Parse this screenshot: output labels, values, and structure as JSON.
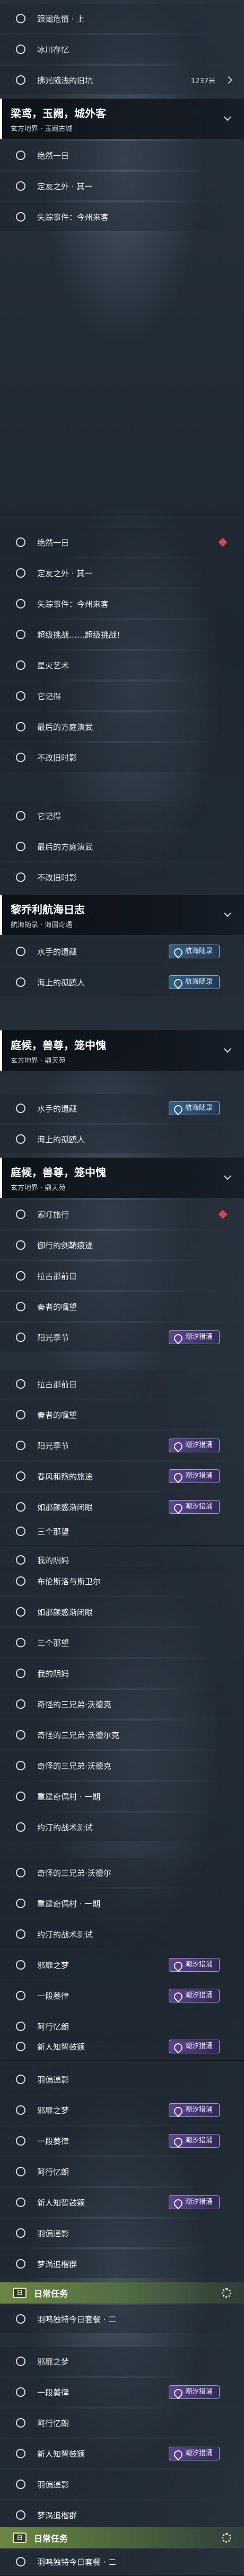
{
  "groups": {
    "g1": {
      "title": "梁鸢，玉阙，城外客",
      "subtitle": "玄方地界 · 玉阙古城"
    },
    "g2": {
      "title": "黎乔利航海日志",
      "subtitle": "航海随录 · 海国奇遇"
    },
    "g3": {
      "title": "庭候，兽尊，笼中愧",
      "subtitle": "玄方地界 · 鼎天苑"
    },
    "g4": {
      "title": "庭候，兽尊，笼中愧",
      "subtitle": "玄方地界 · 鼎天苑"
    }
  },
  "tags": {
    "tide": "潮汐猎涌",
    "sea": "航海随录"
  },
  "daily": {
    "icon": "日",
    "label": "日常任务"
  },
  "meta": {
    "count": "1237米"
  },
  "s1": [
    "跟阔危情 · 上",
    "冰川存忆",
    "拂光随浅的旧坑",
    "",
    "绝然一日",
    "定友之外 · 其一",
    "失踪事件：今州来客"
  ],
  "s2": [
    "绝然一日",
    "定友之外 · 其一",
    "失踪事件：今州来客",
    "超级挑战……超级挑战！",
    "星火艺术",
    "它记得",
    "最后的方庭演武",
    "不改旧时影",
    "它记得",
    "最后的方庭演武",
    "不改旧时影",
    "水手的遗藏",
    "海上的孤鸥人"
  ],
  "s3": [
    "水手的遗藏",
    "海上的孤鸥人",
    "索叮旅行",
    "御行的剑鞘痕迹",
    "拉古那前日",
    "秦者的嘱望",
    "阳光季节",
    "拉古那前日",
    "秦者的嘱望",
    "阳光季节",
    "春风和煦的旅途",
    "如那颜惑渐闭眼",
    "三个那望",
    "我的阴妈",
    "布伦斯洛与斯卫尔"
  ],
  "s4": [
    "如那颜惑渐闭眼",
    "三个那望",
    "我的阴妈",
    "奇怪的三兄弟·沃德克",
    "奇怪的三兄弟·沃德尔克",
    "奇怪的三兄弟·沃德克",
    "重建奇偶村 · 一期",
    "约汀的战术测试",
    "奇怪的三兄弟·沃德尔",
    "重建奇偶村 · 一期",
    "约汀的战术测试",
    "邪靡之梦",
    "一段蓁律",
    "阿行忆朗",
    "新人知智鼓颖",
    "羽偏递影"
  ],
  "s5": [
    "邪靡之梦",
    "一段蓁律",
    "阿行忆朗",
    "新人知智鼓颖",
    "羽偏递影",
    "梦涡追榴群",
    "羽鸣独特今日套餐 · 二",
    "邪靡之梦",
    "一段蓁律",
    "阿行忆朗",
    "新人知智鼓颖",
    "羽偏递影",
    "梦涡追榴群",
    "羽鸣独特今日套餐 · 二"
  ]
}
